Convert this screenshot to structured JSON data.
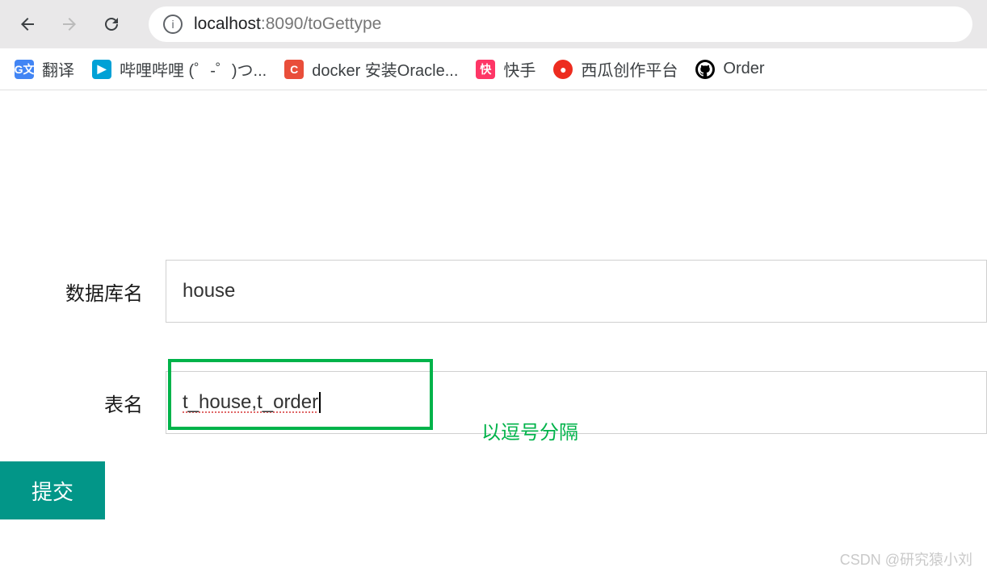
{
  "browser": {
    "url_host": "localhost",
    "url_port_path": ":8090/toGettype"
  },
  "bookmarks": [
    {
      "icon": "gt-icon",
      "glyph": "G文",
      "label": "翻译"
    },
    {
      "icon": "bili-icon",
      "glyph": "▶",
      "label": "哔哩哔哩 (゜-゜)つ..."
    },
    {
      "icon": "c-icon",
      "glyph": "C",
      "label": "docker 安装Oracle..."
    },
    {
      "icon": "ks-icon",
      "glyph": "快",
      "label": "快手"
    },
    {
      "icon": "xg-icon",
      "glyph": "●",
      "label": "西瓜创作平台"
    },
    {
      "icon": "gh-icon",
      "glyph": "⊙",
      "label": "Order"
    }
  ],
  "form": {
    "db_label": "数据库名",
    "db_value": "house",
    "table_label": "表名",
    "table_value": "t_house,t_order",
    "submit_label": "提交"
  },
  "annotation": {
    "hint": "以逗号分隔"
  },
  "watermark": "CSDN @研究猿小刘"
}
